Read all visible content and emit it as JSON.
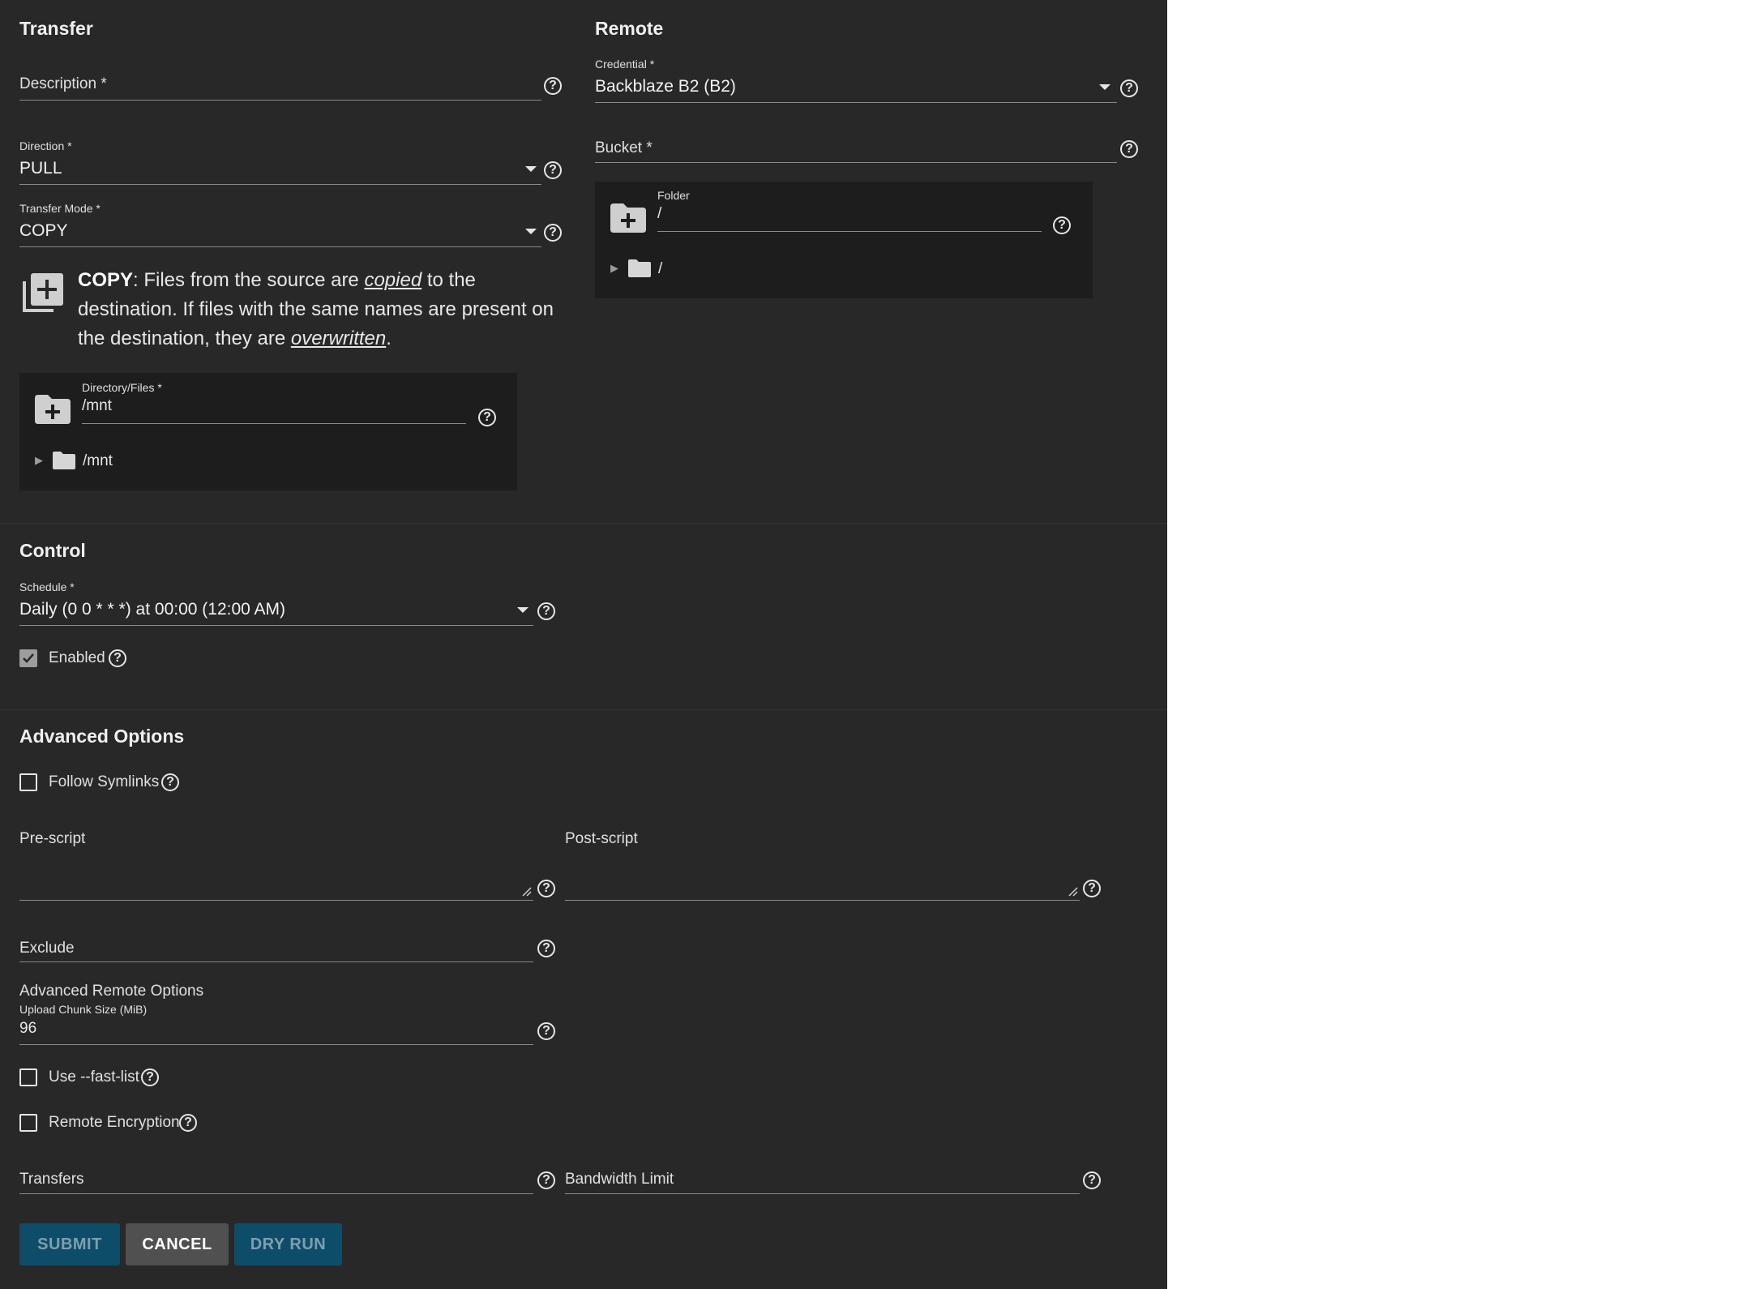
{
  "transfer": {
    "title": "Transfer",
    "description_label": "Description *",
    "description_value": "",
    "direction_label": "Direction *",
    "direction_value": "PULL",
    "mode_label": "Transfer Mode *",
    "mode_value": "COPY",
    "mode_desc_bold": "COPY",
    "mode_desc_1": ": Files from the source are ",
    "mode_desc_em1": "copied",
    "mode_desc_2": " to the destination. If files with the same names are present on the destination, they are ",
    "mode_desc_em2": "overwritten",
    "mode_desc_3": ".",
    "dir_label": "Directory/Files *",
    "dir_value": "/mnt",
    "dir_tree_item": "/mnt"
  },
  "remote": {
    "title": "Remote",
    "credential_label": "Credential *",
    "credential_value": "Backblaze B2 (B2)",
    "bucket_label": "Bucket *",
    "folder_label": "Folder",
    "folder_value": "/",
    "folder_tree_item": "/"
  },
  "control": {
    "title": "Control",
    "schedule_label": "Schedule *",
    "schedule_value": "Daily (0 0 * * *) at 00:00 (12:00 AM)",
    "enabled_label": "Enabled",
    "enabled_checked": true
  },
  "advanced": {
    "title": "Advanced Options",
    "follow_symlinks_label": "Follow Symlinks",
    "follow_symlinks_checked": false,
    "prescript_label": "Pre-script",
    "postscript_label": "Post-script",
    "exclude_label": "Exclude",
    "adv_remote_label": "Advanced Remote Options",
    "chunk_label": "Upload Chunk Size (MiB)",
    "chunk_value": "96",
    "fastlist_label": "Use --fast-list",
    "fastlist_checked": false,
    "encryption_label": "Remote Encryption",
    "encryption_checked": false,
    "transfers_label": "Transfers",
    "bandwidth_label": "Bandwidth Limit"
  },
  "buttons": {
    "submit": "SUBMIT",
    "cancel": "CANCEL",
    "dry_run": "DRY RUN"
  },
  "icons": {
    "help": "help-circle-icon",
    "caret": "caret-down-icon",
    "folder_add": "folder-plus-icon",
    "folder": "folder-icon",
    "copy_mode": "library-plus-icon",
    "checkmark": "check-icon"
  },
  "colors": {
    "panel_bg": "#282828",
    "explorer_bg": "#1d1d1d",
    "primary_button": "#0e5a7a",
    "cancel_button": "#505050"
  }
}
